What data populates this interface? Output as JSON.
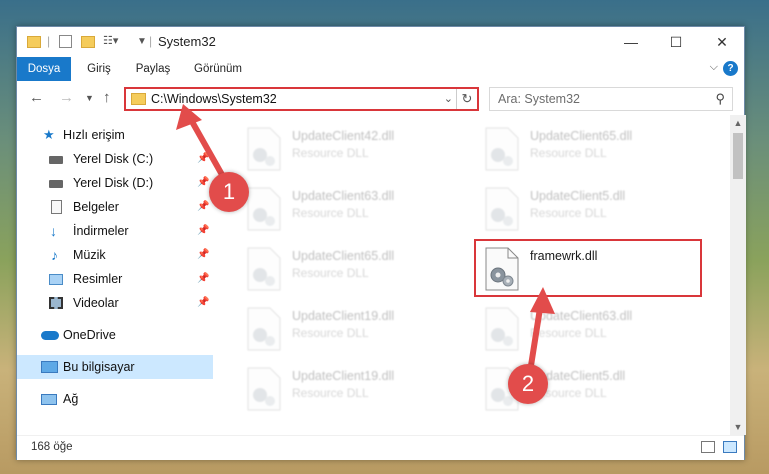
{
  "window": {
    "title": "System32",
    "controls": {
      "minimize": "—",
      "maximize": "☐",
      "close": "✕"
    }
  },
  "ribbon": {
    "tabs": [
      "Dosya",
      "Giriş",
      "Paylaş",
      "Görünüm"
    ],
    "active_tab": "Dosya",
    "help": "?"
  },
  "nav": {
    "address": "C:\\Windows\\System32",
    "search_placeholder": "Ara: System32"
  },
  "sidebar": {
    "items": [
      {
        "label": "Hızlı erişim",
        "icon": "star-icon",
        "pinned": false
      },
      {
        "label": "Yerel Disk (C:)",
        "icon": "drive-icon",
        "pinned": true
      },
      {
        "label": "Yerel Disk (D:)",
        "icon": "drive-icon",
        "pinned": true
      },
      {
        "label": "Belgeler",
        "icon": "document-icon",
        "pinned": true
      },
      {
        "label": "İndirmeler",
        "icon": "download-icon",
        "pinned": true
      },
      {
        "label": "Müzik",
        "icon": "music-icon",
        "pinned": true
      },
      {
        "label": "Resimler",
        "icon": "picture-icon",
        "pinned": true
      },
      {
        "label": "Videolar",
        "icon": "video-icon",
        "pinned": true
      },
      {
        "label": "OneDrive",
        "icon": "cloud-icon",
        "pinned": false
      },
      {
        "label": "Bu bilgisayar",
        "icon": "computer-icon",
        "pinned": false,
        "selected": true
      },
      {
        "label": "Ağ",
        "icon": "network-icon",
        "pinned": false
      }
    ]
  },
  "files": [
    {
      "name": "UpdateClient42.dll",
      "type": "Resource DLL"
    },
    {
      "name": "UpdateClient65.dll",
      "type": "Resource DLL"
    },
    {
      "name": "UpdateClient63.dll",
      "type": "Resource DLL"
    },
    {
      "name": "UpdateClient5.dll",
      "type": "Resource DLL"
    },
    {
      "name": "UpdateClient65.dll",
      "type": "Resource DLL"
    },
    {
      "name": "framewrk.dll",
      "type": "",
      "highlighted": true
    },
    {
      "name": "UpdateClient19.dll",
      "type": "Resource DLL"
    },
    {
      "name": "UpdateClient63.dll",
      "type": "Resource DLL"
    },
    {
      "name": "UpdateClient19.dll",
      "type": "Resource DLL"
    },
    {
      "name": "UpdateClient5.dll",
      "type": "Resource DLL"
    }
  ],
  "status": {
    "item_count": "168 öğe"
  },
  "annotations": {
    "step1": "1",
    "step2": "2"
  },
  "colors": {
    "accent": "#1979ca",
    "highlight": "#d9363a",
    "badge": "#e24c4b"
  }
}
